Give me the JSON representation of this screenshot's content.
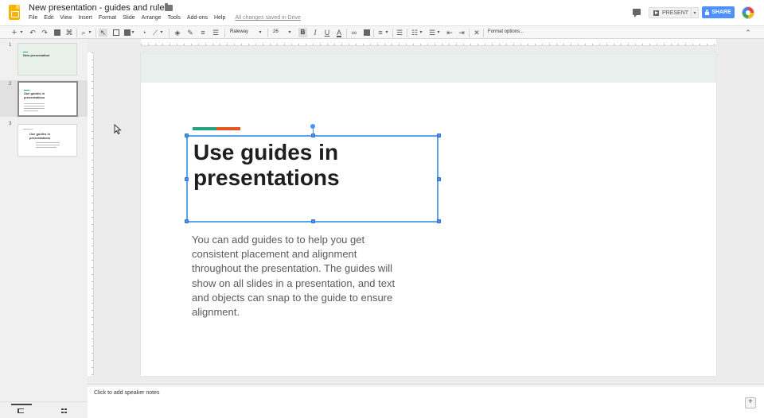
{
  "header": {
    "doc_title": "New presentation - guides and rulers",
    "menu": [
      "File",
      "Edit",
      "View",
      "Insert",
      "Format",
      "Slide",
      "Arrange",
      "Tools",
      "Add-ons",
      "Help"
    ],
    "saved_status": "All changes saved in Drive",
    "present_label": "PRESENT",
    "share_label": "SHARE"
  },
  "toolbar": {
    "font": "Raleway",
    "font_size": "26",
    "bold_label": "B",
    "italic_label": "I",
    "underline_label": "U",
    "text_color_label": "A",
    "format_options": "Format options..."
  },
  "filmstrip": {
    "selected_index": 1,
    "slides": [
      {
        "number": "1",
        "title": "New presentation"
      },
      {
        "number": "2",
        "title": "Use guides in presentations"
      },
      {
        "number": "3",
        "title": "Use guides in presentations"
      }
    ]
  },
  "slide": {
    "title_line1": "Use guides in",
    "title_line2": "presentations",
    "body": "You can add guides to to help you get consistent placement and alignment throughout the presentation. The guides will show on all slides in a presentation, and text and objects can snap to the guide to ensure alignment."
  },
  "notes": {
    "placeholder": "Click to add speaker notes"
  },
  "colors": {
    "accent_teal": "#21a383",
    "accent_orange": "#e3541e",
    "share_blue": "#4d90fe",
    "selection_blue": "#5aa4e8",
    "app_yellow": "#f4b400"
  }
}
